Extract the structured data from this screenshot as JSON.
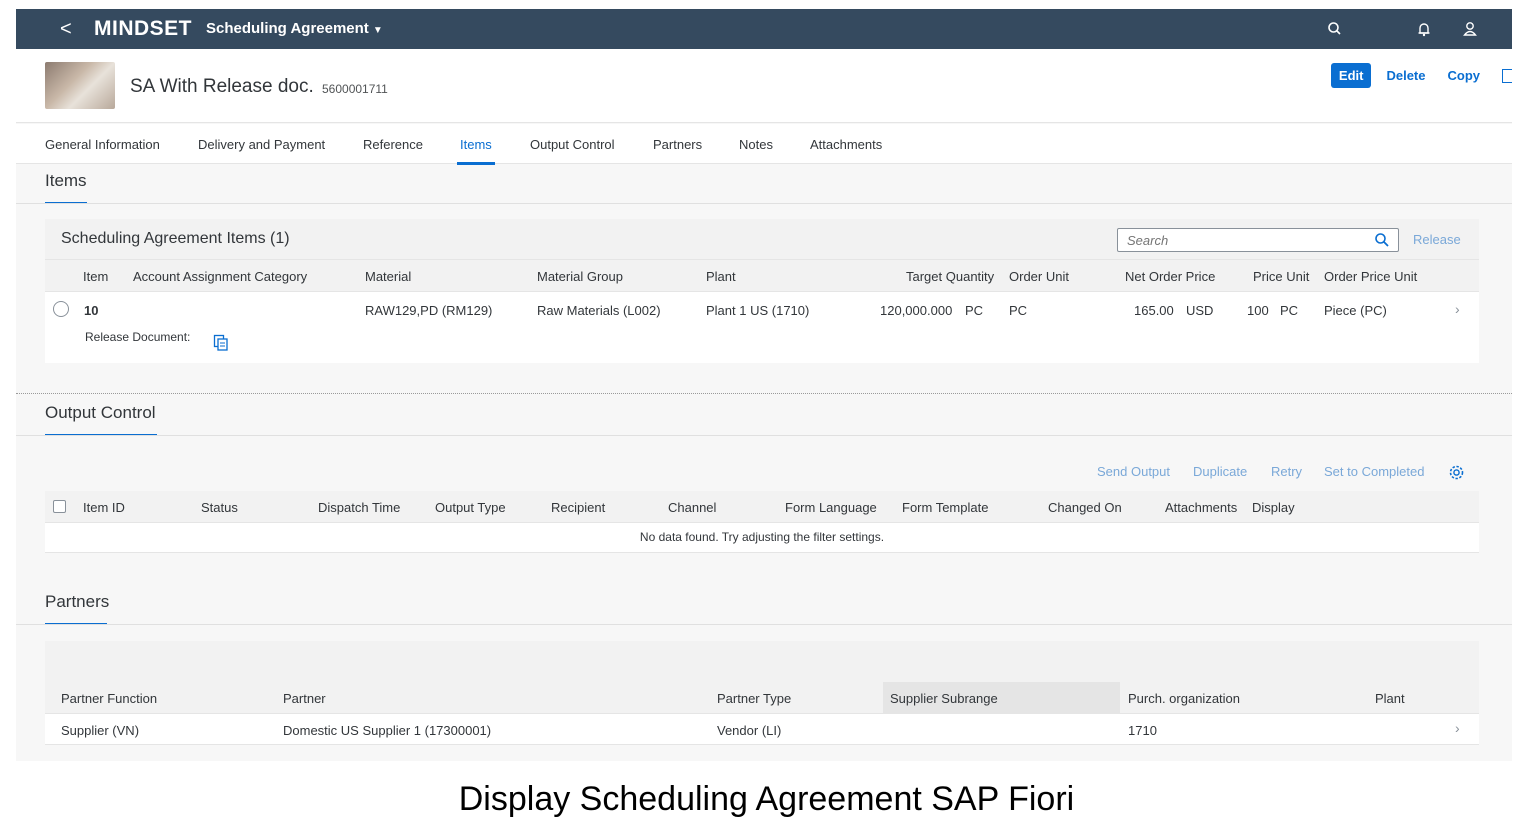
{
  "shell": {
    "back_glyph": "<",
    "logo": "MINDSET",
    "app_title": "Scheduling Agreement",
    "icons": [
      "search-icon",
      "bell-icon",
      "user-icon"
    ]
  },
  "header": {
    "title": "SA With Release doc.",
    "object_id": "5600001711",
    "actions": {
      "edit": "Edit",
      "delete": "Delete",
      "copy": "Copy"
    }
  },
  "tabs": [
    {
      "label": "General Information"
    },
    {
      "label": "Delivery and Payment"
    },
    {
      "label": "Reference"
    },
    {
      "label": "Items"
    },
    {
      "label": "Output Control"
    },
    {
      "label": "Partners"
    },
    {
      "label": "Notes"
    },
    {
      "label": "Attachments"
    }
  ],
  "items_section": {
    "title": "Items",
    "table_title": "Scheduling Agreement Items (1)",
    "search_placeholder": "Search",
    "release": "Release",
    "columns": [
      "Item",
      "Account Assignment Category",
      "Material",
      "Material Group",
      "Plant",
      "Target Quantity",
      "Order Unit",
      "Net Order Price",
      "Price Unit",
      "Order Price Unit"
    ],
    "rows": [
      {
        "item": "10",
        "material": "RAW129,PD (RM129)",
        "material_group": "Raw Materials (L002)",
        "plant": "Plant 1 US (1710)",
        "target_quantity": "120,000.000",
        "target_unit": "PC",
        "order_unit": "PC",
        "net_price": "165.00",
        "currency": "USD",
        "price_unit": "100",
        "price_unit_uom": "PC",
        "order_price_unit": "Piece (PC)",
        "release_document_label": "Release Document:"
      }
    ]
  },
  "output_section": {
    "title": "Output Control",
    "actions": {
      "send": "Send Output",
      "duplicate": "Duplicate",
      "retry": "Retry",
      "complete": "Set to Completed"
    },
    "columns": [
      "Item ID",
      "Status",
      "Dispatch Time",
      "Output Type",
      "Recipient",
      "Channel",
      "Form Language",
      "Form Template",
      "Changed On",
      "Attachments",
      "Display"
    ],
    "empty_text": "No data found. Try adjusting the filter settings."
  },
  "partners_section": {
    "title": "Partners",
    "columns": [
      "Partner Function",
      "Partner",
      "Partner Type",
      "Supplier Subrange",
      "Purch. organization",
      "Plant"
    ],
    "rows": [
      {
        "function": "Supplier (VN)",
        "partner": "Domestic US Supplier 1 (17300001)",
        "type": "Vendor (LI)",
        "subrange": "",
        "purch_org": "1710",
        "plant": ""
      }
    ]
  },
  "caption": "Display Scheduling Agreement SAP Fiori",
  "colors": {
    "shell": "#354a5f",
    "accent": "#0a6ed1",
    "disabled_link": "#7aa8d8"
  }
}
